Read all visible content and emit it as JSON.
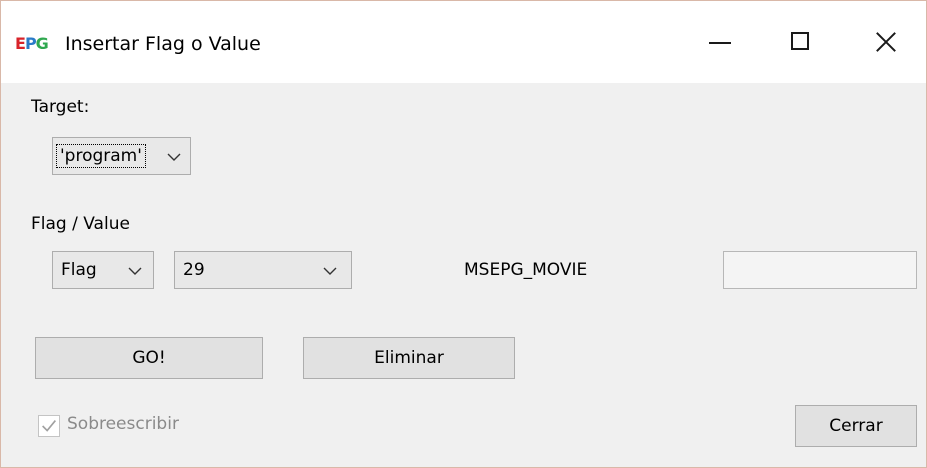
{
  "window": {
    "title": "Insertar Flag o Value",
    "icon_text": {
      "e": "E",
      "p": "P",
      "g": "G"
    },
    "controls": [
      "minimize-icon",
      "maximize-icon",
      "close-icon"
    ]
  },
  "target": {
    "label": "Target:",
    "selected": "'program'"
  },
  "flag_value": {
    "label": "Flag / Value",
    "type_selected": "Flag",
    "number_selected": "29",
    "constant_name": "MSEPG_MOVIE",
    "value_input": ""
  },
  "actions": {
    "go_label": "GO!",
    "delete_label": "Eliminar",
    "close_label": "Cerrar"
  },
  "options": {
    "overwrite_label": "Sobreescribir",
    "overwrite_checked": true,
    "overwrite_enabled": false
  },
  "colors": {
    "window_bg": "#f0f0f0",
    "titlebar_bg": "#ffffff",
    "button_bg": "#e1e1e1",
    "disabled_text": "#8a8a8a",
    "icon_e": "#d8232a",
    "icon_p": "#2a7bc8",
    "icon_g": "#2fa84f"
  }
}
